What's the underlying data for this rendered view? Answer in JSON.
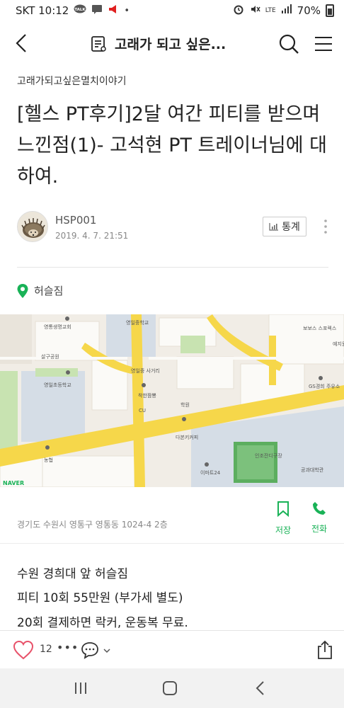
{
  "status_bar": {
    "carrier_time": "SKT 10:12",
    "talk_badge": "TALK",
    "signal_label": "LTE",
    "battery": "70%"
  },
  "header": {
    "title": "고래가 되고 싶은..."
  },
  "post": {
    "blog_name": "고래가되고싶은멸치이야기",
    "title": "[헬스 PT후기]2달 여간 피티를 받으며 느낀점(1)- 고석현 PT 트레이너님에 대하여.",
    "author_name": "HSP001",
    "date": "2019. 4. 7. 21:51",
    "stats_label": "통계"
  },
  "place": {
    "name": "허슬짐",
    "address": "경기도 수원시 영통구 영통동 1024-4 2층",
    "save_label": "저장",
    "call_label": "전화"
  },
  "map": {
    "labels": [
      "영통생명교회",
      "영일중학교",
      "보보스 스포렉스",
      "예지원",
      "살구공원",
      "영일초등학교",
      "영일중 사거리",
      "착한짬뽕",
      "GS경희 주유소",
      "CU",
      "학원",
      "다본키커피",
      "이마트24",
      "인조잔디구장",
      "공과대학관",
      "농협",
      "NAVER"
    ],
    "colors": {
      "road": "#f6d74a",
      "park": "#c8e3b1",
      "block": "#ffffff",
      "ground": "#f1ede6",
      "campus": "#d5dde6"
    }
  },
  "body": {
    "line1": "수원 경희대 앞 허슬짐",
    "line2": "피티 10회 55만원 (부가세 별도)",
    "line3": "20회 결제하면 락커, 운동복 무료."
  },
  "actions": {
    "like_count": "12",
    "dots": "•••"
  },
  "colors": {
    "accent_green": "#19b257",
    "like_pink": "#e8526a"
  }
}
